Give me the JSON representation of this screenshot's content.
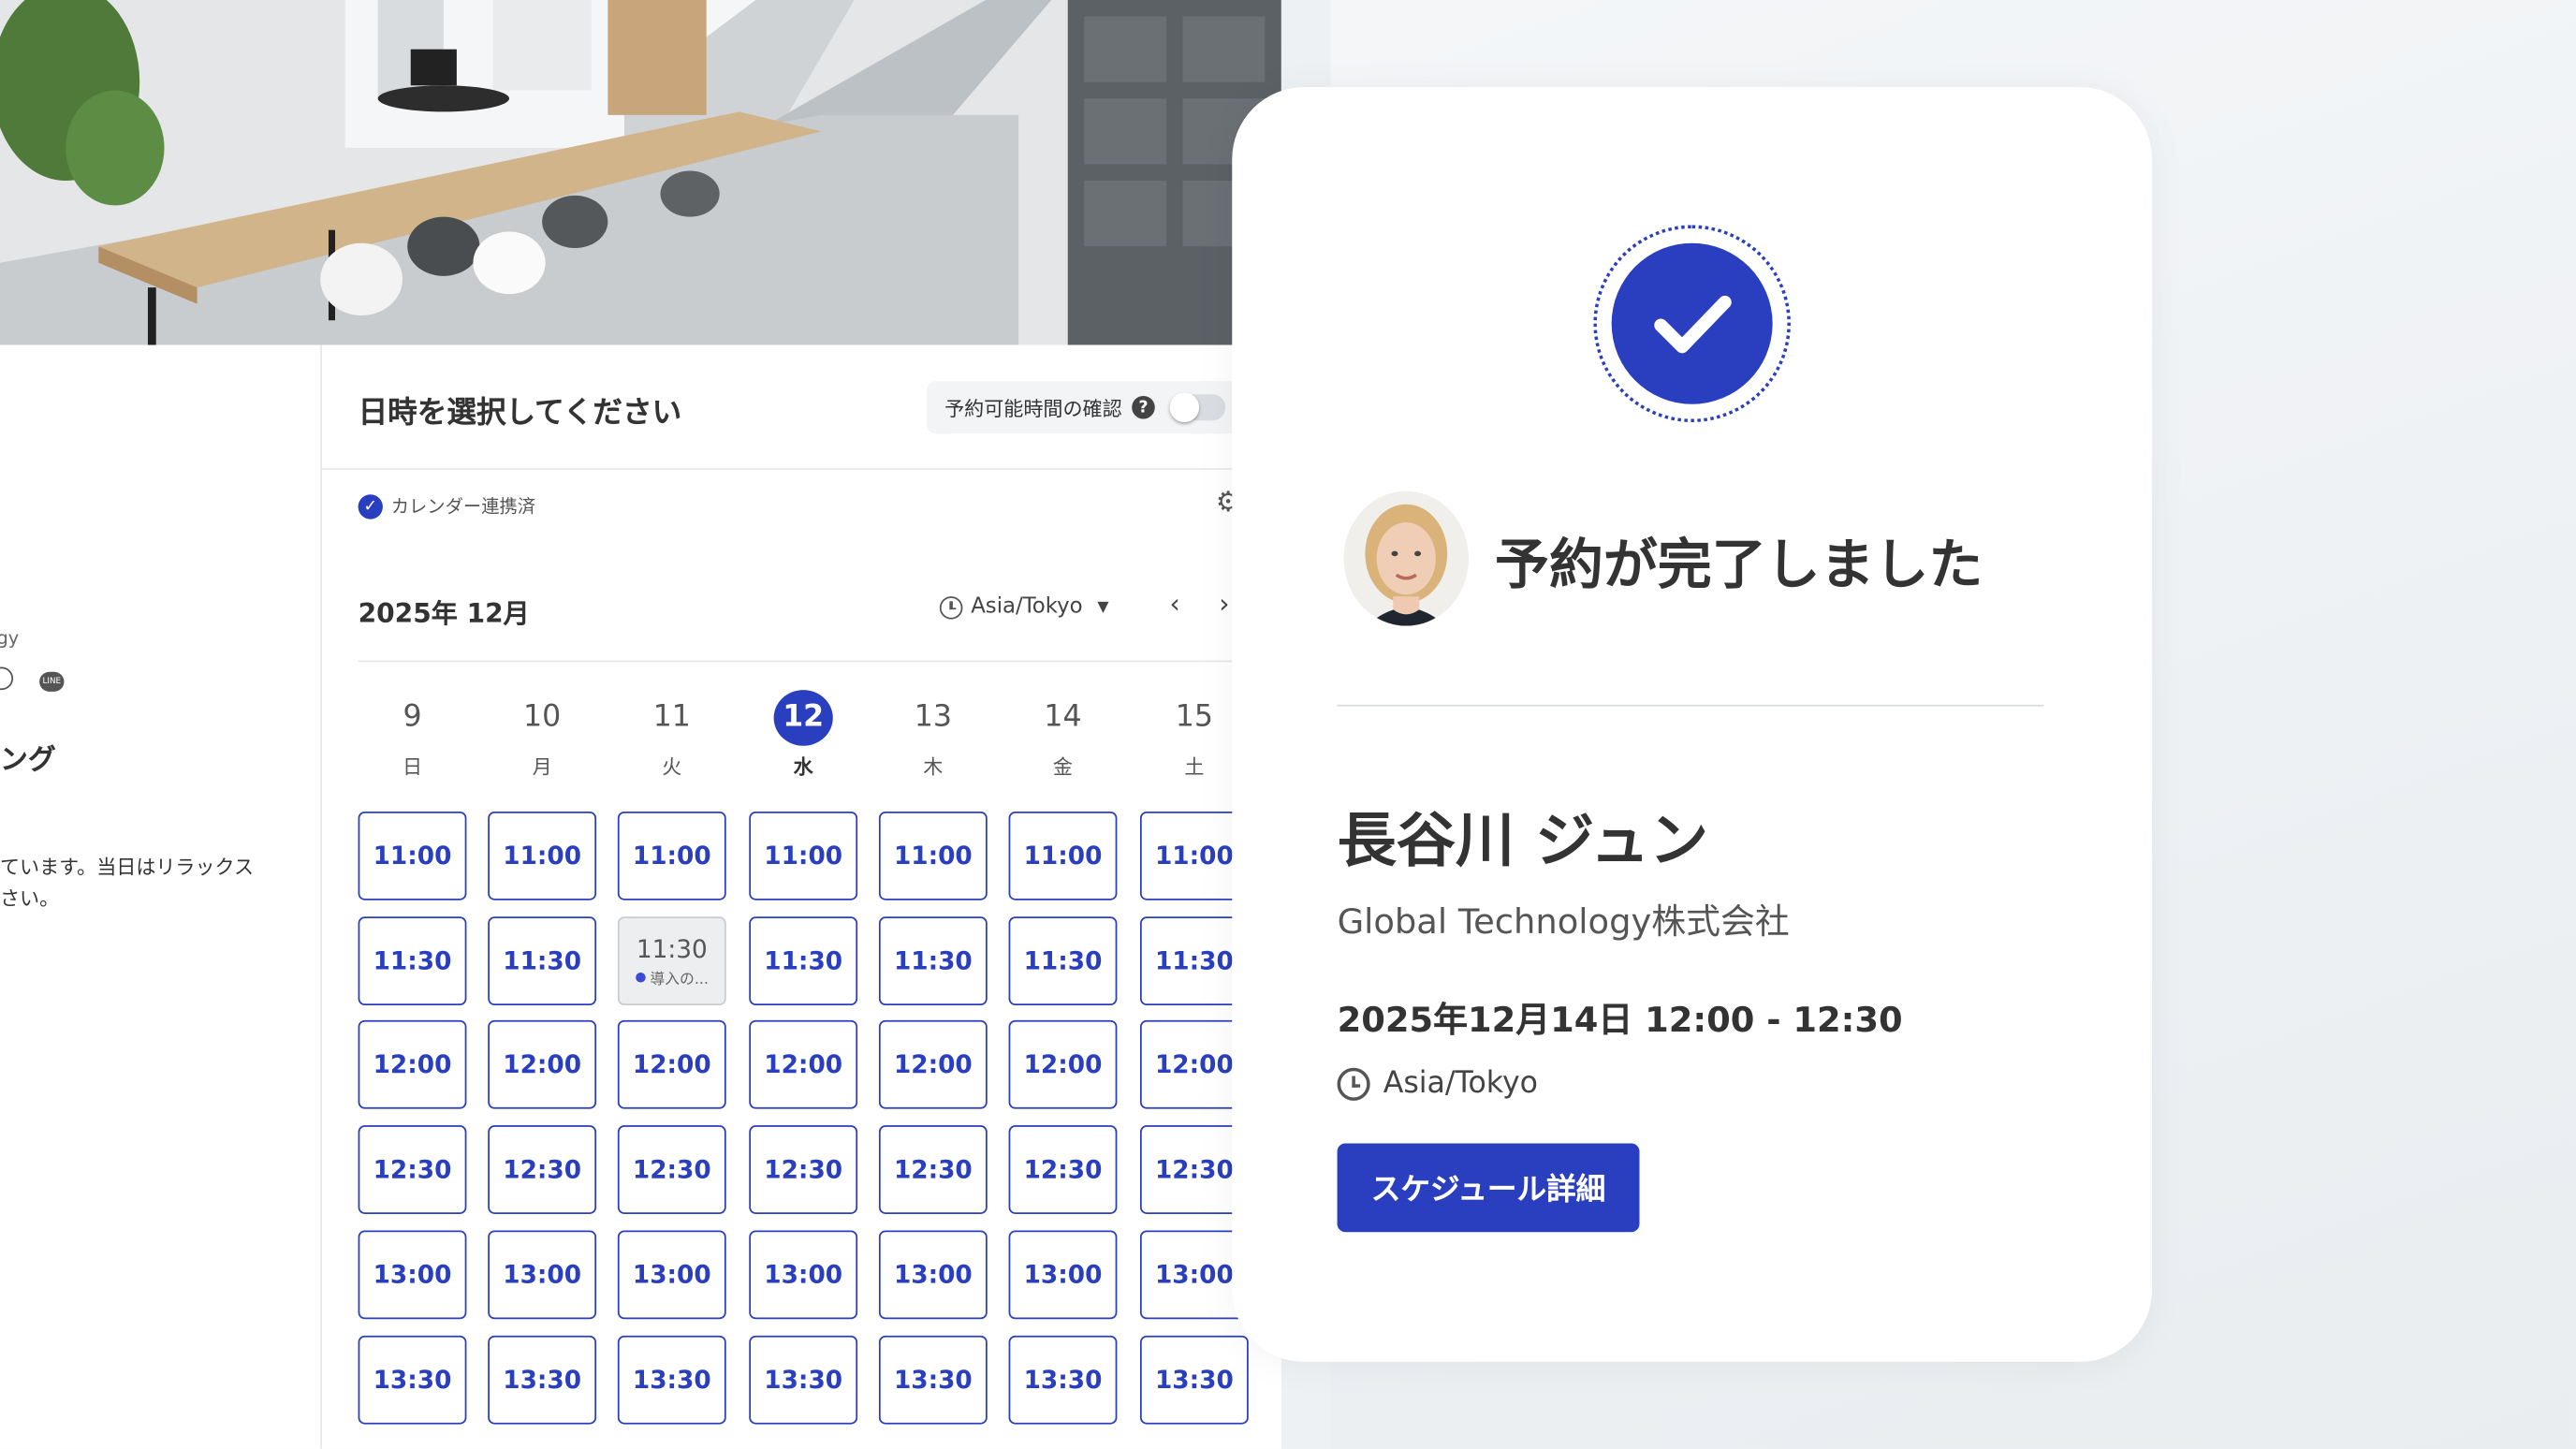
{
  "calendar": {
    "title": "日時を選択してください",
    "availability_label": "予約可能時間の確認",
    "help_icon": "?",
    "connected_label": "カレンダー連携済",
    "month_label": "2025年 12月",
    "timezone": "Asia/Tokyo",
    "days": [
      {
        "num": "9",
        "wk": "日"
      },
      {
        "num": "10",
        "wk": "月"
      },
      {
        "num": "11",
        "wk": "火"
      },
      {
        "num": "12",
        "wk": "水",
        "selected": true
      },
      {
        "num": "13",
        "wk": "木"
      },
      {
        "num": "14",
        "wk": "金"
      },
      {
        "num": "15",
        "wk": "土"
      }
    ],
    "times": [
      "11:00",
      "11:30",
      "12:00",
      "12:30",
      "13:00",
      "13:30"
    ],
    "booked_slot": {
      "day_index": 2,
      "time": "11:30",
      "sub_label": "導入の..."
    }
  },
  "left_panel": {
    "company_fragment": "gy",
    "title_fragment": "ング",
    "desc_line1": "ています。当日はリラックス",
    "desc_line2": "さい。"
  },
  "confirmation": {
    "title": "予約が完了しました",
    "name": "長谷川 ジュン",
    "company": "Global Technology株式会社",
    "datetime": "2025年12月14日 12:00 - 12:30",
    "timezone": "Asia/Tokyo",
    "button_label": "スケジュール詳細"
  },
  "colors": {
    "accent": "#2a3fbf",
    "booked_bg": "#eceeef",
    "page_bg": "#eef1f4"
  },
  "icons": [
    "check-circle-icon",
    "help-icon",
    "gear-icon",
    "clock-icon",
    "chevron-left-icon",
    "chevron-right-icon",
    "caret-down-icon",
    "globe-icon",
    "line-icon"
  ]
}
